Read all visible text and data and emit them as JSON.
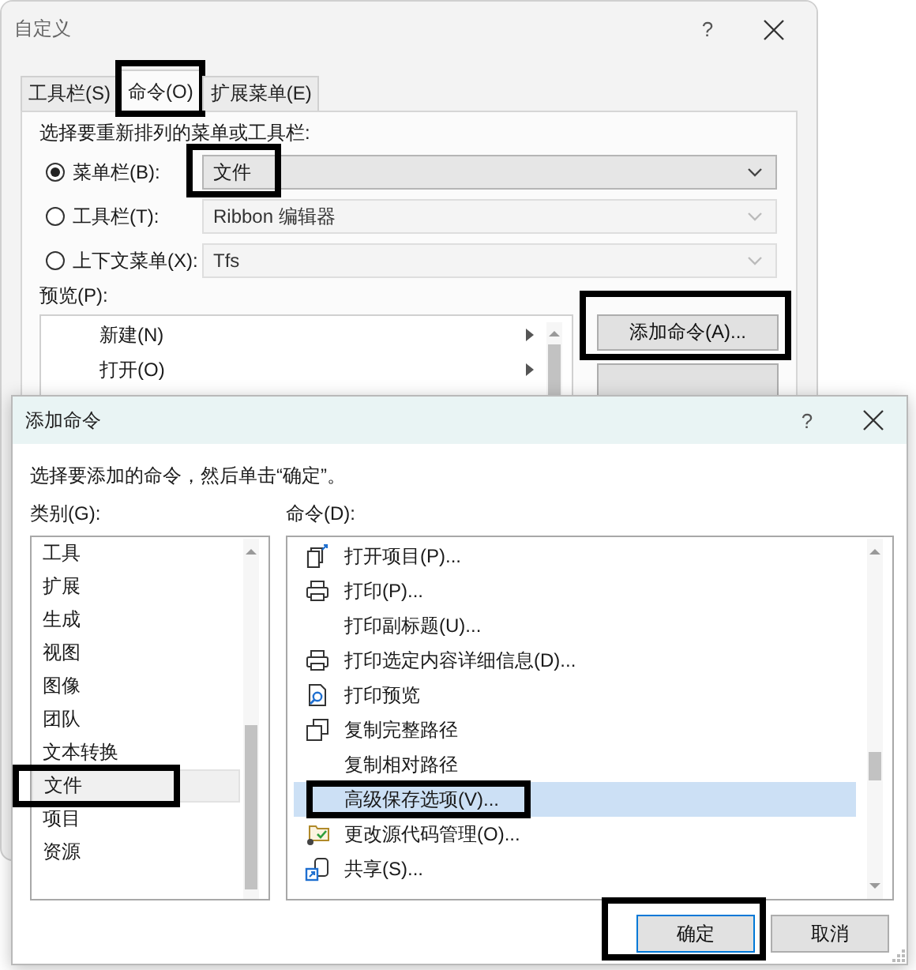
{
  "customize_dialog": {
    "title": "自定义",
    "help": "?",
    "tabs": [
      {
        "label": "工具栏(S)",
        "selected": false,
        "highlighted": false
      },
      {
        "label": "命令(O)",
        "selected": true,
        "highlighted": true
      },
      {
        "label": "扩展菜单(E)",
        "selected": false,
        "highlighted": false
      }
    ],
    "choose_label": "选择要重新排列的菜单或工具栏:",
    "targets": [
      {
        "label": "菜单栏(B):",
        "selected": true,
        "value": "文件",
        "disabled": false,
        "highlighted": true
      },
      {
        "label": "工具栏(T):",
        "selected": false,
        "value": "Ribbon 编辑器",
        "disabled": true,
        "highlighted": false
      },
      {
        "label": "上下文菜单(X):",
        "selected": false,
        "value": "Tfs",
        "disabled": true,
        "highlighted": false
      }
    ],
    "preview_label": "预览(P):",
    "preview_items": [
      {
        "label": "新建(N)",
        "has_submenu": true
      },
      {
        "label": "打开(O)",
        "has_submenu": true
      }
    ],
    "buttons": [
      {
        "label": "添加命令(A)...",
        "highlighted": true
      }
    ]
  },
  "add_command_dialog": {
    "title": "添加命令",
    "help": "?",
    "instruction": "选择要添加的命令，然后单击“确定”。",
    "categories_label": "类别(G):",
    "categories": [
      {
        "label": "工具",
        "selected": false,
        "highlighted": false
      },
      {
        "label": "扩展",
        "selected": false,
        "highlighted": false
      },
      {
        "label": "生成",
        "selected": false,
        "highlighted": false
      },
      {
        "label": "视图",
        "selected": false,
        "highlighted": false
      },
      {
        "label": "图像",
        "selected": false,
        "highlighted": false
      },
      {
        "label": "团队",
        "selected": false,
        "highlighted": false
      },
      {
        "label": "文本转换",
        "selected": false,
        "highlighted": false
      },
      {
        "label": "文件",
        "selected": true,
        "highlighted": true
      },
      {
        "label": "项目",
        "selected": false,
        "highlighted": false
      },
      {
        "label": "资源",
        "selected": false,
        "highlighted": false
      }
    ],
    "commands_label": "命令(D):",
    "commands": [
      {
        "label": "打开项目(P)...",
        "kind": "open",
        "selected": false,
        "highlighted": false
      },
      {
        "label": "打印(P)...",
        "kind": "print",
        "selected": false,
        "highlighted": false
      },
      {
        "label": "打印副标题(U)...",
        "kind": "plain",
        "selected": false,
        "highlighted": false
      },
      {
        "label": "打印选定内容详细信息(D)...",
        "kind": "print",
        "selected": false,
        "highlighted": false
      },
      {
        "label": "打印预览",
        "kind": "preview",
        "selected": false,
        "highlighted": false
      },
      {
        "label": "复制完整路径",
        "kind": "copy",
        "selected": false,
        "highlighted": false
      },
      {
        "label": "复制相对路径",
        "kind": "plain",
        "selected": false,
        "highlighted": false
      },
      {
        "label": "高级保存选项(V)...",
        "kind": "plain",
        "selected": true,
        "highlighted": true
      },
      {
        "label": "更改源代码管理(O)...",
        "kind": "source",
        "selected": false,
        "highlighted": false
      },
      {
        "label": "共享(S)...",
        "kind": "share",
        "selected": false,
        "highlighted": false
      }
    ],
    "buttons": [
      {
        "label": "确定",
        "default": true,
        "highlighted": true
      },
      {
        "label": "取消",
        "default": false,
        "highlighted": false
      }
    ]
  }
}
